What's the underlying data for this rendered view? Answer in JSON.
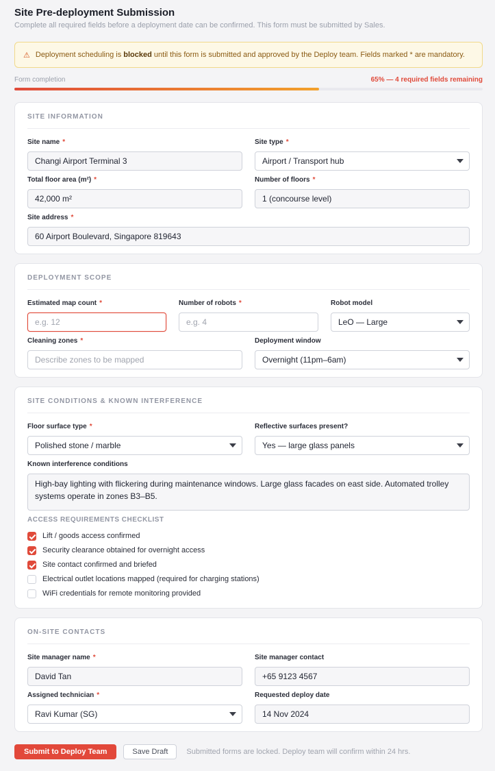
{
  "header": {
    "title": "Site Pre-deployment Submission",
    "subtitle": "Complete all required fields before a deployment date can be confirmed. This form must be submitted by Sales."
  },
  "banner": {
    "icon": "warning-icon",
    "text_before": "Deployment scheduling is ",
    "text_bold": "blocked",
    "text_after": " until this form is submitted and approved by the Deploy team. Fields marked * are mandatory."
  },
  "progress": {
    "label": "Form completion",
    "status": "65% — 4 required fields remaining",
    "percent": 65
  },
  "sections": {
    "site_info": {
      "title": "SITE INFORMATION",
      "site_name": {
        "label": "Site name",
        "value": "Changi Airport Terminal 3"
      },
      "site_type": {
        "label": "Site type",
        "value": "Airport / Transport hub"
      },
      "floor_area": {
        "label": "Total floor area (m²)",
        "value": "42,000 m²"
      },
      "floors": {
        "label": "Number of floors",
        "value": "1 (concourse level)"
      },
      "address": {
        "label": "Site address",
        "value": "60 Airport Boulevard, Singapore 819643"
      }
    },
    "scope": {
      "title": "DEPLOYMENT SCOPE",
      "map_count": {
        "label": "Estimated map count",
        "placeholder": "e.g. 12"
      },
      "robots": {
        "label": "Number of robots",
        "placeholder": "e.g. 4"
      },
      "model": {
        "label": "Robot model",
        "value": "LeO — Large"
      },
      "zones": {
        "label": "Cleaning zones",
        "placeholder": "Describe zones to be mapped"
      },
      "window": {
        "label": "Deployment window",
        "value": "Overnight (11pm–6am)"
      }
    },
    "conditions": {
      "title": "SITE CONDITIONS & KNOWN INTERFERENCE",
      "surface": {
        "label": "Floor surface type",
        "value": "Polished stone / marble"
      },
      "reflective": {
        "label": "Reflective surfaces present?",
        "value": "Yes — large glass panels"
      },
      "interference": {
        "label": "Known interference conditions",
        "value": "High-bay lighting with flickering during maintenance windows. Large glass facades on east side. Automated trolley systems operate in zones B3–B5."
      },
      "checklist_title": "ACCESS REQUIREMENTS CHECKLIST",
      "checklist": [
        {
          "label": "Lift / goods access confirmed",
          "checked": true
        },
        {
          "label": "Security clearance obtained for overnight access",
          "checked": true
        },
        {
          "label": "Site contact confirmed and briefed",
          "checked": true
        },
        {
          "label": "Electrical outlet locations mapped (required for charging stations)",
          "checked": false
        },
        {
          "label": "WiFi credentials for remote monitoring provided",
          "checked": false
        }
      ]
    },
    "contacts": {
      "title": "ON-SITE CONTACTS",
      "manager_name": {
        "label": "Site manager name",
        "value": "David Tan"
      },
      "manager_contact": {
        "label": "Site manager contact",
        "value": "+65 9123 4567"
      },
      "technician": {
        "label": "Assigned technician",
        "value": "Ravi Kumar (SG)"
      },
      "deploy_date": {
        "label": "Requested deploy date",
        "value": "14 Nov 2024"
      }
    }
  },
  "footer": {
    "submit_label": "Submit to Deploy Team",
    "draft_label": "Save Draft",
    "note": "Submitted forms are locked. Deploy team will confirm within 24 hrs."
  },
  "colors": {
    "accent": "#e2483a",
    "progress_end": "#f2a12c",
    "banner_bg": "#fdf8e6"
  }
}
